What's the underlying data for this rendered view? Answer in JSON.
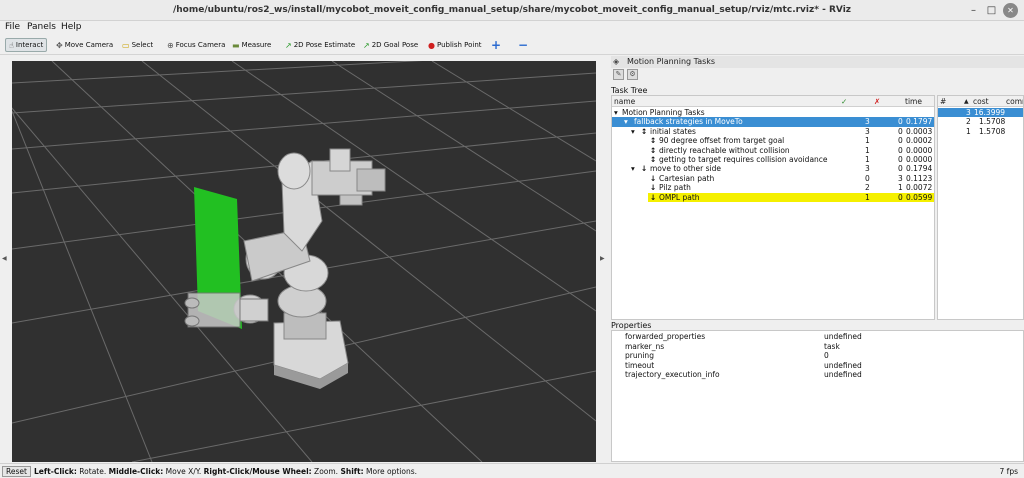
{
  "window": {
    "title": "/home/ubuntu/ros2_ws/install/mycobot_moveit_config_manual_setup/share/mycobot_moveit_config_manual_setup/rviz/mtc.rviz* - RViz"
  },
  "menu": [
    "File",
    "Panels",
    "Help"
  ],
  "toolbar": {
    "interact": "Interact",
    "move_camera": "Move Camera",
    "select": "Select",
    "focus_camera": "Focus Camera",
    "measure": "Measure",
    "pose_estimate": "2D Pose Estimate",
    "goal_pose": "2D Goal Pose",
    "publish_point": "Publish Point",
    "add": "+",
    "remove": "−"
  },
  "panel": {
    "title": "Motion Planning Tasks",
    "task_tree_label": "Task Tree",
    "columns": {
      "name": "name",
      "ok": "✓",
      "fail": "✗",
      "time": "time"
    },
    "rows": [
      {
        "name": "Motion Planning Tasks",
        "ok": "",
        "fail": "",
        "time": ""
      },
      {
        "name": "fallback strategies in MoveTo",
        "ok": "3",
        "fail": "0",
        "time": "0.1797"
      },
      {
        "name": "initial states",
        "ok": "3",
        "fail": "0",
        "time": "0.0003"
      },
      {
        "name": "90 degree offset from target goal",
        "ok": "1",
        "fail": "0",
        "time": "0.0002"
      },
      {
        "name": "directly reachable without collision",
        "ok": "1",
        "fail": "0",
        "time": "0.0000"
      },
      {
        "name": "getting to target requires collision avoidance",
        "ok": "1",
        "fail": "0",
        "time": "0.0000"
      },
      {
        "name": "move to other side",
        "ok": "3",
        "fail": "0",
        "time": "0.1794"
      },
      {
        "name": "Cartesian path",
        "ok": "0",
        "fail": "3",
        "time": "0.1123"
      },
      {
        "name": "Pilz path",
        "ok": "2",
        "fail": "1",
        "time": "0.0072"
      },
      {
        "name": "OMPL path",
        "ok": "1",
        "fail": "0",
        "time": "0.0599"
      }
    ],
    "solutions": {
      "columns": {
        "num": "#",
        "cost": "cost",
        "comment": "comm"
      },
      "rows": [
        {
          "num": "3",
          "cost": "16.3999"
        },
        {
          "num": "2",
          "cost": "1.5708"
        },
        {
          "num": "1",
          "cost": "1.5708"
        }
      ]
    },
    "properties_label": "Properties",
    "properties": [
      {
        "key": "forwarded_properties",
        "value": "undefined"
      },
      {
        "key": "marker_ns",
        "value": "task"
      },
      {
        "key": "pruning",
        "value": "0"
      },
      {
        "key": "timeout",
        "value": "undefined"
      },
      {
        "key": "trajectory_execution_info",
        "value": "undefined"
      }
    ]
  },
  "status": {
    "reset": "Reset",
    "lc": "Left-Click:",
    "lc_t": " Rotate. ",
    "mc": "Middle-Click:",
    "mc_t": " Move X/Y. ",
    "rc": "Right-Click/Mouse Wheel:",
    "rc_t": " Zoom. ",
    "sh": "Shift:",
    "sh_t": " More options.",
    "fps": "7 fps"
  },
  "colors": {
    "selection": "#3a8ed3",
    "highlight": "#f5f000",
    "plane": "#22c022",
    "viewport": "#303030"
  }
}
